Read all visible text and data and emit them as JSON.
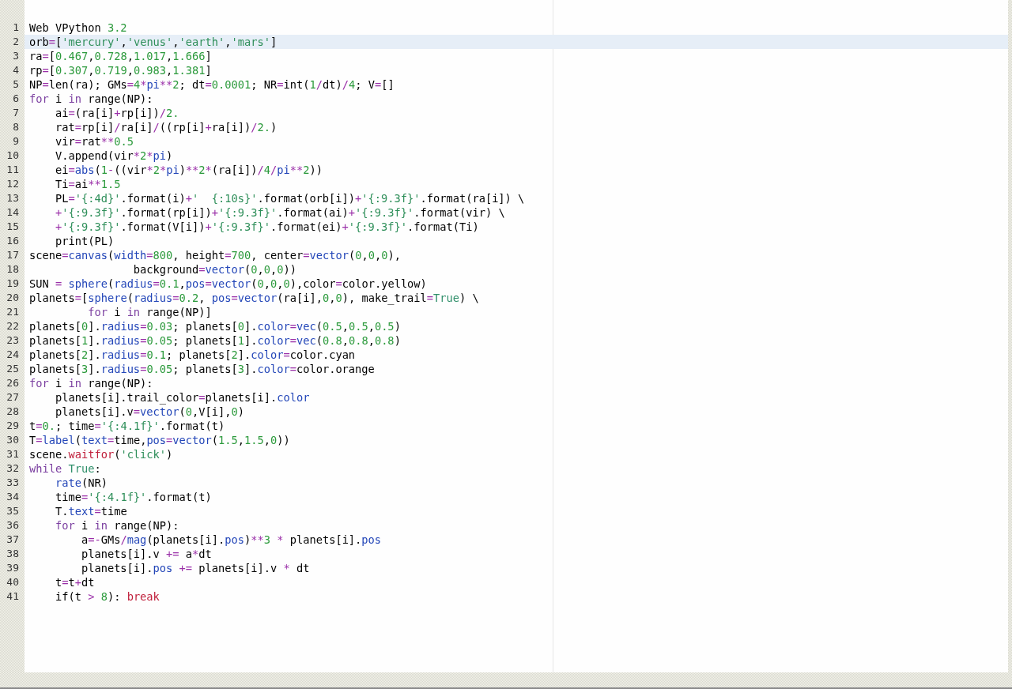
{
  "editor": {
    "lines": [
      {
        "number": "1",
        "current": false,
        "tokens": [
          {
            "text": "Web VPython ",
            "kind": "plain"
          },
          {
            "text": "3.2",
            "kind": "num"
          }
        ]
      },
      {
        "number": "2",
        "current": true,
        "tokens": [
          {
            "text": "orb",
            "kind": "plain"
          },
          {
            "text": "=",
            "kind": "op"
          },
          {
            "text": "[",
            "kind": "plain"
          },
          {
            "text": "'mercury'",
            "kind": "str"
          },
          {
            "text": ",",
            "kind": "plain"
          },
          {
            "text": "'venus'",
            "kind": "str"
          },
          {
            "text": ",",
            "kind": "plain"
          },
          {
            "text": "'earth'",
            "kind": "str"
          },
          {
            "text": ",",
            "kind": "plain"
          },
          {
            "text": "'mars'",
            "kind": "str"
          },
          {
            "text": "]",
            "kind": "plain"
          }
        ]
      },
      {
        "number": "3",
        "current": false,
        "tokens": [
          {
            "text": "ra",
            "kind": "plain"
          },
          {
            "text": "=",
            "kind": "op"
          },
          {
            "text": "[",
            "kind": "plain"
          },
          {
            "text": "0.467",
            "kind": "num"
          },
          {
            "text": ",",
            "kind": "plain"
          },
          {
            "text": "0.728",
            "kind": "num"
          },
          {
            "text": ",",
            "kind": "plain"
          },
          {
            "text": "1.017",
            "kind": "num"
          },
          {
            "text": ",",
            "kind": "plain"
          },
          {
            "text": "1.666",
            "kind": "num"
          },
          {
            "text": "]",
            "kind": "plain"
          }
        ]
      },
      {
        "number": "4",
        "current": false,
        "tokens": [
          {
            "text": "rp",
            "kind": "plain"
          },
          {
            "text": "=",
            "kind": "op"
          },
          {
            "text": "[",
            "kind": "plain"
          },
          {
            "text": "0.307",
            "kind": "num"
          },
          {
            "text": ",",
            "kind": "plain"
          },
          {
            "text": "0.719",
            "kind": "num"
          },
          {
            "text": ",",
            "kind": "plain"
          },
          {
            "text": "0.983",
            "kind": "num"
          },
          {
            "text": ",",
            "kind": "plain"
          },
          {
            "text": "1.381",
            "kind": "num"
          },
          {
            "text": "]",
            "kind": "plain"
          }
        ]
      },
      {
        "number": "5",
        "current": false,
        "tokens": [
          {
            "text": "NP",
            "kind": "plain"
          },
          {
            "text": "=",
            "kind": "op"
          },
          {
            "text": "len(ra); GMs",
            "kind": "plain"
          },
          {
            "text": "=",
            "kind": "op"
          },
          {
            "text": "4",
            "kind": "num"
          },
          {
            "text": "*",
            "kind": "op"
          },
          {
            "text": "pi",
            "kind": "fn"
          },
          {
            "text": "**",
            "kind": "op"
          },
          {
            "text": "2",
            "kind": "num"
          },
          {
            "text": "; dt",
            "kind": "plain"
          },
          {
            "text": "=",
            "kind": "op"
          },
          {
            "text": "0.0001",
            "kind": "num"
          },
          {
            "text": "; NR",
            "kind": "plain"
          },
          {
            "text": "=",
            "kind": "op"
          },
          {
            "text": "int(",
            "kind": "plain"
          },
          {
            "text": "1",
            "kind": "num"
          },
          {
            "text": "/",
            "kind": "op"
          },
          {
            "text": "dt)",
            "kind": "plain"
          },
          {
            "text": "/",
            "kind": "op"
          },
          {
            "text": "4",
            "kind": "num"
          },
          {
            "text": "; V",
            "kind": "plain"
          },
          {
            "text": "=",
            "kind": "op"
          },
          {
            "text": "[]",
            "kind": "plain"
          }
        ]
      },
      {
        "number": "6",
        "current": false,
        "tokens": [
          {
            "text": "for",
            "kind": "kw"
          },
          {
            "text": " i ",
            "kind": "plain"
          },
          {
            "text": "in",
            "kind": "kw"
          },
          {
            "text": " range(NP):",
            "kind": "plain"
          }
        ]
      },
      {
        "number": "7",
        "current": false,
        "tokens": [
          {
            "text": "    ai",
            "kind": "plain"
          },
          {
            "text": "=",
            "kind": "op"
          },
          {
            "text": "(ra[i]",
            "kind": "plain"
          },
          {
            "text": "+",
            "kind": "op"
          },
          {
            "text": "rp[i])",
            "kind": "plain"
          },
          {
            "text": "/",
            "kind": "op"
          },
          {
            "text": "2.",
            "kind": "num"
          }
        ]
      },
      {
        "number": "8",
        "current": false,
        "tokens": [
          {
            "text": "    rat",
            "kind": "plain"
          },
          {
            "text": "=",
            "kind": "op"
          },
          {
            "text": "rp[i]",
            "kind": "plain"
          },
          {
            "text": "/",
            "kind": "op"
          },
          {
            "text": "ra[i]",
            "kind": "plain"
          },
          {
            "text": "/",
            "kind": "op"
          },
          {
            "text": "((rp[i]",
            "kind": "plain"
          },
          {
            "text": "+",
            "kind": "op"
          },
          {
            "text": "ra[i])",
            "kind": "plain"
          },
          {
            "text": "/",
            "kind": "op"
          },
          {
            "text": "2.",
            "kind": "num"
          },
          {
            "text": ")",
            "kind": "plain"
          }
        ]
      },
      {
        "number": "9",
        "current": false,
        "tokens": [
          {
            "text": "    vir",
            "kind": "plain"
          },
          {
            "text": "=",
            "kind": "op"
          },
          {
            "text": "rat",
            "kind": "plain"
          },
          {
            "text": "**",
            "kind": "op"
          },
          {
            "text": "0.5",
            "kind": "num"
          }
        ]
      },
      {
        "number": "10",
        "current": false,
        "tokens": [
          {
            "text": "    V.append(vir",
            "kind": "plain"
          },
          {
            "text": "*",
            "kind": "op"
          },
          {
            "text": "2",
            "kind": "num"
          },
          {
            "text": "*",
            "kind": "op"
          },
          {
            "text": "pi",
            "kind": "fn"
          },
          {
            "text": ")",
            "kind": "plain"
          }
        ]
      },
      {
        "number": "11",
        "current": false,
        "tokens": [
          {
            "text": "    ei",
            "kind": "plain"
          },
          {
            "text": "=",
            "kind": "op"
          },
          {
            "text": "abs",
            "kind": "fn"
          },
          {
            "text": "(",
            "kind": "plain"
          },
          {
            "text": "1",
            "kind": "num"
          },
          {
            "text": "-",
            "kind": "op"
          },
          {
            "text": "((vir",
            "kind": "plain"
          },
          {
            "text": "*",
            "kind": "op"
          },
          {
            "text": "2",
            "kind": "num"
          },
          {
            "text": "*",
            "kind": "op"
          },
          {
            "text": "pi",
            "kind": "fn"
          },
          {
            "text": ")",
            "kind": "plain"
          },
          {
            "text": "**",
            "kind": "op"
          },
          {
            "text": "2",
            "kind": "num"
          },
          {
            "text": "*",
            "kind": "op"
          },
          {
            "text": "(ra[i])",
            "kind": "plain"
          },
          {
            "text": "/",
            "kind": "op"
          },
          {
            "text": "4",
            "kind": "num"
          },
          {
            "text": "/",
            "kind": "op"
          },
          {
            "text": "pi",
            "kind": "fn"
          },
          {
            "text": "**",
            "kind": "op"
          },
          {
            "text": "2",
            "kind": "num"
          },
          {
            "text": "))",
            "kind": "plain"
          }
        ]
      },
      {
        "number": "12",
        "current": false,
        "tokens": [
          {
            "text": "    Ti",
            "kind": "plain"
          },
          {
            "text": "=",
            "kind": "op"
          },
          {
            "text": "ai",
            "kind": "plain"
          },
          {
            "text": "**",
            "kind": "op"
          },
          {
            "text": "1.5",
            "kind": "num"
          }
        ]
      },
      {
        "number": "13",
        "current": false,
        "tokens": [
          {
            "text": "    PL",
            "kind": "plain"
          },
          {
            "text": "=",
            "kind": "op"
          },
          {
            "text": "'{:4d}'",
            "kind": "str"
          },
          {
            "text": ".format(i)",
            "kind": "plain"
          },
          {
            "text": "+",
            "kind": "op"
          },
          {
            "text": "'  {:10s}'",
            "kind": "str"
          },
          {
            "text": ".format(orb[i])",
            "kind": "plain"
          },
          {
            "text": "+",
            "kind": "op"
          },
          {
            "text": "'{:9.3f}'",
            "kind": "str"
          },
          {
            "text": ".format(ra[i]) \\",
            "kind": "plain"
          }
        ]
      },
      {
        "number": "14",
        "current": false,
        "tokens": [
          {
            "text": "    +",
            "kind": "op"
          },
          {
            "text": "'{:9.3f}'",
            "kind": "str"
          },
          {
            "text": ".format(rp[i])",
            "kind": "plain"
          },
          {
            "text": "+",
            "kind": "op"
          },
          {
            "text": "'{:9.3f}'",
            "kind": "str"
          },
          {
            "text": ".format(ai)",
            "kind": "plain"
          },
          {
            "text": "+",
            "kind": "op"
          },
          {
            "text": "'{:9.3f}'",
            "kind": "str"
          },
          {
            "text": ".format(vir) \\",
            "kind": "plain"
          }
        ]
      },
      {
        "number": "15",
        "current": false,
        "tokens": [
          {
            "text": "    +",
            "kind": "op"
          },
          {
            "text": "'{:9.3f}'",
            "kind": "str"
          },
          {
            "text": ".format(V[i])",
            "kind": "plain"
          },
          {
            "text": "+",
            "kind": "op"
          },
          {
            "text": "'{:9.3f}'",
            "kind": "str"
          },
          {
            "text": ".format(ei)",
            "kind": "plain"
          },
          {
            "text": "+",
            "kind": "op"
          },
          {
            "text": "'{:9.3f}'",
            "kind": "str"
          },
          {
            "text": ".format(Ti)",
            "kind": "plain"
          }
        ]
      },
      {
        "number": "16",
        "current": false,
        "tokens": [
          {
            "text": "    print(PL)",
            "kind": "plain"
          }
        ]
      },
      {
        "number": "17",
        "current": false,
        "tokens": [
          {
            "text": "scene",
            "kind": "plain"
          },
          {
            "text": "=",
            "kind": "op"
          },
          {
            "text": "canvas",
            "kind": "fn"
          },
          {
            "text": "(",
            "kind": "plain"
          },
          {
            "text": "width",
            "kind": "fn"
          },
          {
            "text": "=",
            "kind": "op"
          },
          {
            "text": "800",
            "kind": "num"
          },
          {
            "text": ", height",
            "kind": "plain"
          },
          {
            "text": "=",
            "kind": "op"
          },
          {
            "text": "700",
            "kind": "num"
          },
          {
            "text": ", center",
            "kind": "plain"
          },
          {
            "text": "=",
            "kind": "op"
          },
          {
            "text": "vector",
            "kind": "fn"
          },
          {
            "text": "(",
            "kind": "plain"
          },
          {
            "text": "0",
            "kind": "num"
          },
          {
            "text": ",",
            "kind": "plain"
          },
          {
            "text": "0",
            "kind": "num"
          },
          {
            "text": ",",
            "kind": "plain"
          },
          {
            "text": "0",
            "kind": "num"
          },
          {
            "text": "),",
            "kind": "plain"
          }
        ]
      },
      {
        "number": "18",
        "current": false,
        "tokens": [
          {
            "text": "                background",
            "kind": "plain"
          },
          {
            "text": "=",
            "kind": "op"
          },
          {
            "text": "vector",
            "kind": "fn"
          },
          {
            "text": "(",
            "kind": "plain"
          },
          {
            "text": "0",
            "kind": "num"
          },
          {
            "text": ",",
            "kind": "plain"
          },
          {
            "text": "0",
            "kind": "num"
          },
          {
            "text": ",",
            "kind": "plain"
          },
          {
            "text": "0",
            "kind": "num"
          },
          {
            "text": "))",
            "kind": "plain"
          }
        ]
      },
      {
        "number": "19",
        "current": false,
        "tokens": [
          {
            "text": "SUN ",
            "kind": "plain"
          },
          {
            "text": "= ",
            "kind": "op"
          },
          {
            "text": "sphere",
            "kind": "fn"
          },
          {
            "text": "(",
            "kind": "plain"
          },
          {
            "text": "radius",
            "kind": "fn"
          },
          {
            "text": "=",
            "kind": "op"
          },
          {
            "text": "0.1",
            "kind": "num"
          },
          {
            "text": ",",
            "kind": "plain"
          },
          {
            "text": "pos",
            "kind": "fn"
          },
          {
            "text": "=",
            "kind": "op"
          },
          {
            "text": "vector",
            "kind": "fn"
          },
          {
            "text": "(",
            "kind": "plain"
          },
          {
            "text": "0",
            "kind": "num"
          },
          {
            "text": ",",
            "kind": "plain"
          },
          {
            "text": "0",
            "kind": "num"
          },
          {
            "text": ",",
            "kind": "plain"
          },
          {
            "text": "0",
            "kind": "num"
          },
          {
            "text": "),color",
            "kind": "plain"
          },
          {
            "text": "=",
            "kind": "op"
          },
          {
            "text": "color.yellow)",
            "kind": "plain"
          }
        ]
      },
      {
        "number": "20",
        "current": false,
        "tokens": [
          {
            "text": "planets",
            "kind": "plain"
          },
          {
            "text": "=",
            "kind": "op"
          },
          {
            "text": "[",
            "kind": "plain"
          },
          {
            "text": "sphere",
            "kind": "fn"
          },
          {
            "text": "(",
            "kind": "plain"
          },
          {
            "text": "radius",
            "kind": "fn"
          },
          {
            "text": "=",
            "kind": "op"
          },
          {
            "text": "0.2",
            "kind": "num"
          },
          {
            "text": ", ",
            "kind": "plain"
          },
          {
            "text": "pos",
            "kind": "fn"
          },
          {
            "text": "=",
            "kind": "op"
          },
          {
            "text": "vector",
            "kind": "fn"
          },
          {
            "text": "(ra[i],",
            "kind": "plain"
          },
          {
            "text": "0",
            "kind": "num"
          },
          {
            "text": ",",
            "kind": "plain"
          },
          {
            "text": "0",
            "kind": "num"
          },
          {
            "text": "), make_trail",
            "kind": "plain"
          },
          {
            "text": "=",
            "kind": "op"
          },
          {
            "text": "True",
            "kind": "const"
          },
          {
            "text": ") \\",
            "kind": "plain"
          }
        ]
      },
      {
        "number": "21",
        "current": false,
        "tokens": [
          {
            "text": "         for",
            "kind": "kw"
          },
          {
            "text": " i ",
            "kind": "plain"
          },
          {
            "text": "in",
            "kind": "kw"
          },
          {
            "text": " range(NP)]",
            "kind": "plain"
          }
        ]
      },
      {
        "number": "22",
        "current": false,
        "tokens": [
          {
            "text": "planets[",
            "kind": "plain"
          },
          {
            "text": "0",
            "kind": "num"
          },
          {
            "text": "].",
            "kind": "plain"
          },
          {
            "text": "radius",
            "kind": "fn"
          },
          {
            "text": "=",
            "kind": "op"
          },
          {
            "text": "0.03",
            "kind": "num"
          },
          {
            "text": "; planets[",
            "kind": "plain"
          },
          {
            "text": "0",
            "kind": "num"
          },
          {
            "text": "].",
            "kind": "plain"
          },
          {
            "text": "color",
            "kind": "fn"
          },
          {
            "text": "=",
            "kind": "op"
          },
          {
            "text": "vec",
            "kind": "fn"
          },
          {
            "text": "(",
            "kind": "plain"
          },
          {
            "text": "0.5",
            "kind": "num"
          },
          {
            "text": ",",
            "kind": "plain"
          },
          {
            "text": "0.5",
            "kind": "num"
          },
          {
            "text": ",",
            "kind": "plain"
          },
          {
            "text": "0.5",
            "kind": "num"
          },
          {
            "text": ")",
            "kind": "plain"
          }
        ]
      },
      {
        "number": "23",
        "current": false,
        "tokens": [
          {
            "text": "planets[",
            "kind": "plain"
          },
          {
            "text": "1",
            "kind": "num"
          },
          {
            "text": "].",
            "kind": "plain"
          },
          {
            "text": "radius",
            "kind": "fn"
          },
          {
            "text": "=",
            "kind": "op"
          },
          {
            "text": "0.05",
            "kind": "num"
          },
          {
            "text": "; planets[",
            "kind": "plain"
          },
          {
            "text": "1",
            "kind": "num"
          },
          {
            "text": "].",
            "kind": "plain"
          },
          {
            "text": "color",
            "kind": "fn"
          },
          {
            "text": "=",
            "kind": "op"
          },
          {
            "text": "vec",
            "kind": "fn"
          },
          {
            "text": "(",
            "kind": "plain"
          },
          {
            "text": "0.8",
            "kind": "num"
          },
          {
            "text": ",",
            "kind": "plain"
          },
          {
            "text": "0.8",
            "kind": "num"
          },
          {
            "text": ",",
            "kind": "plain"
          },
          {
            "text": "0.8",
            "kind": "num"
          },
          {
            "text": ")",
            "kind": "plain"
          }
        ]
      },
      {
        "number": "24",
        "current": false,
        "tokens": [
          {
            "text": "planets[",
            "kind": "plain"
          },
          {
            "text": "2",
            "kind": "num"
          },
          {
            "text": "].",
            "kind": "plain"
          },
          {
            "text": "radius",
            "kind": "fn"
          },
          {
            "text": "=",
            "kind": "op"
          },
          {
            "text": "0.1",
            "kind": "num"
          },
          {
            "text": "; planets[",
            "kind": "plain"
          },
          {
            "text": "2",
            "kind": "num"
          },
          {
            "text": "].",
            "kind": "plain"
          },
          {
            "text": "color",
            "kind": "fn"
          },
          {
            "text": "=",
            "kind": "op"
          },
          {
            "text": "color.cyan",
            "kind": "plain"
          }
        ]
      },
      {
        "number": "25",
        "current": false,
        "tokens": [
          {
            "text": "planets[",
            "kind": "plain"
          },
          {
            "text": "3",
            "kind": "num"
          },
          {
            "text": "].",
            "kind": "plain"
          },
          {
            "text": "radius",
            "kind": "fn"
          },
          {
            "text": "=",
            "kind": "op"
          },
          {
            "text": "0.05",
            "kind": "num"
          },
          {
            "text": "; planets[",
            "kind": "plain"
          },
          {
            "text": "3",
            "kind": "num"
          },
          {
            "text": "].",
            "kind": "plain"
          },
          {
            "text": "color",
            "kind": "fn"
          },
          {
            "text": "=",
            "kind": "op"
          },
          {
            "text": "color.orange",
            "kind": "plain"
          }
        ]
      },
      {
        "number": "26",
        "current": false,
        "tokens": [
          {
            "text": "for",
            "kind": "kw"
          },
          {
            "text": " i ",
            "kind": "plain"
          },
          {
            "text": "in",
            "kind": "kw"
          },
          {
            "text": " range(NP):",
            "kind": "plain"
          }
        ]
      },
      {
        "number": "27",
        "current": false,
        "tokens": [
          {
            "text": "    planets[i].trail_color",
            "kind": "plain"
          },
          {
            "text": "=",
            "kind": "op"
          },
          {
            "text": "planets[i].",
            "kind": "plain"
          },
          {
            "text": "color",
            "kind": "fn"
          }
        ]
      },
      {
        "number": "28",
        "current": false,
        "tokens": [
          {
            "text": "    planets[i].v",
            "kind": "plain"
          },
          {
            "text": "=",
            "kind": "op"
          },
          {
            "text": "vector",
            "kind": "fn"
          },
          {
            "text": "(",
            "kind": "plain"
          },
          {
            "text": "0",
            "kind": "num"
          },
          {
            "text": ",V[i],",
            "kind": "plain"
          },
          {
            "text": "0",
            "kind": "num"
          },
          {
            "text": ")",
            "kind": "plain"
          }
        ]
      },
      {
        "number": "29",
        "current": false,
        "tokens": [
          {
            "text": "t",
            "kind": "plain"
          },
          {
            "text": "=",
            "kind": "op"
          },
          {
            "text": "0.",
            "kind": "num"
          },
          {
            "text": "; time",
            "kind": "plain"
          },
          {
            "text": "=",
            "kind": "op"
          },
          {
            "text": "'{:4.1f}'",
            "kind": "str"
          },
          {
            "text": ".format(t)",
            "kind": "plain"
          }
        ]
      },
      {
        "number": "30",
        "current": false,
        "tokens": [
          {
            "text": "T",
            "kind": "plain"
          },
          {
            "text": "=",
            "kind": "op"
          },
          {
            "text": "label",
            "kind": "fn"
          },
          {
            "text": "(",
            "kind": "plain"
          },
          {
            "text": "text",
            "kind": "fn"
          },
          {
            "text": "=",
            "kind": "op"
          },
          {
            "text": "time,",
            "kind": "plain"
          },
          {
            "text": "pos",
            "kind": "fn"
          },
          {
            "text": "=",
            "kind": "op"
          },
          {
            "text": "vector",
            "kind": "fn"
          },
          {
            "text": "(",
            "kind": "plain"
          },
          {
            "text": "1.5",
            "kind": "num"
          },
          {
            "text": ",",
            "kind": "plain"
          },
          {
            "text": "1.5",
            "kind": "num"
          },
          {
            "text": ",",
            "kind": "plain"
          },
          {
            "text": "0",
            "kind": "num"
          },
          {
            "text": "))",
            "kind": "plain"
          }
        ]
      },
      {
        "number": "31",
        "current": false,
        "tokens": [
          {
            "text": "scene.",
            "kind": "plain"
          },
          {
            "text": "waitfor",
            "kind": "special"
          },
          {
            "text": "(",
            "kind": "plain"
          },
          {
            "text": "'click'",
            "kind": "str"
          },
          {
            "text": ")",
            "kind": "plain"
          }
        ]
      },
      {
        "number": "32",
        "current": false,
        "tokens": [
          {
            "text": "while",
            "kind": "kw"
          },
          {
            "text": " True",
            "kind": "const"
          },
          {
            "text": ":",
            "kind": "plain"
          }
        ]
      },
      {
        "number": "33",
        "current": false,
        "tokens": [
          {
            "text": "    rate",
            "kind": "fn"
          },
          {
            "text": "(NR)",
            "kind": "plain"
          }
        ]
      },
      {
        "number": "34",
        "current": false,
        "tokens": [
          {
            "text": "    time",
            "kind": "plain"
          },
          {
            "text": "=",
            "kind": "op"
          },
          {
            "text": "'{:4.1f}'",
            "kind": "str"
          },
          {
            "text": ".format(t)",
            "kind": "plain"
          }
        ]
      },
      {
        "number": "35",
        "current": false,
        "tokens": [
          {
            "text": "    T.",
            "kind": "plain"
          },
          {
            "text": "text",
            "kind": "fn"
          },
          {
            "text": "=",
            "kind": "op"
          },
          {
            "text": "time",
            "kind": "plain"
          }
        ]
      },
      {
        "number": "36",
        "current": false,
        "tokens": [
          {
            "text": "    for",
            "kind": "kw"
          },
          {
            "text": " i ",
            "kind": "plain"
          },
          {
            "text": "in",
            "kind": "kw"
          },
          {
            "text": " range(NP):",
            "kind": "plain"
          }
        ]
      },
      {
        "number": "37",
        "current": false,
        "tokens": [
          {
            "text": "        a",
            "kind": "plain"
          },
          {
            "text": "=-",
            "kind": "op"
          },
          {
            "text": "GMs",
            "kind": "plain"
          },
          {
            "text": "/",
            "kind": "op"
          },
          {
            "text": "mag",
            "kind": "fn"
          },
          {
            "text": "(planets[i].",
            "kind": "plain"
          },
          {
            "text": "pos",
            "kind": "fn"
          },
          {
            "text": ")",
            "kind": "plain"
          },
          {
            "text": "**",
            "kind": "op"
          },
          {
            "text": "3 ",
            "kind": "num"
          },
          {
            "text": "*",
            "kind": "op"
          },
          {
            "text": " planets[i].",
            "kind": "plain"
          },
          {
            "text": "pos",
            "kind": "fn"
          }
        ]
      },
      {
        "number": "38",
        "current": false,
        "tokens": [
          {
            "text": "        planets[i].v ",
            "kind": "plain"
          },
          {
            "text": "+=",
            "kind": "op"
          },
          {
            "text": " a",
            "kind": "plain"
          },
          {
            "text": "*",
            "kind": "op"
          },
          {
            "text": "dt",
            "kind": "plain"
          }
        ]
      },
      {
        "number": "39",
        "current": false,
        "tokens": [
          {
            "text": "        planets[i].",
            "kind": "plain"
          },
          {
            "text": "pos ",
            "kind": "fn"
          },
          {
            "text": "+=",
            "kind": "op"
          },
          {
            "text": " planets[i].v ",
            "kind": "plain"
          },
          {
            "text": "*",
            "kind": "op"
          },
          {
            "text": " dt",
            "kind": "plain"
          }
        ]
      },
      {
        "number": "40",
        "current": false,
        "tokens": [
          {
            "text": "    t",
            "kind": "plain"
          },
          {
            "text": "=",
            "kind": "op"
          },
          {
            "text": "t",
            "kind": "plain"
          },
          {
            "text": "+",
            "kind": "op"
          },
          {
            "text": "dt",
            "kind": "plain"
          }
        ]
      },
      {
        "number": "41",
        "current": false,
        "tokens": [
          {
            "text": "    if(t ",
            "kind": "plain"
          },
          {
            "text": "> ",
            "kind": "op"
          },
          {
            "text": "8",
            "kind": "num"
          },
          {
            "text": "): ",
            "kind": "plain"
          },
          {
            "text": "break",
            "kind": "special"
          }
        ]
      }
    ]
  }
}
